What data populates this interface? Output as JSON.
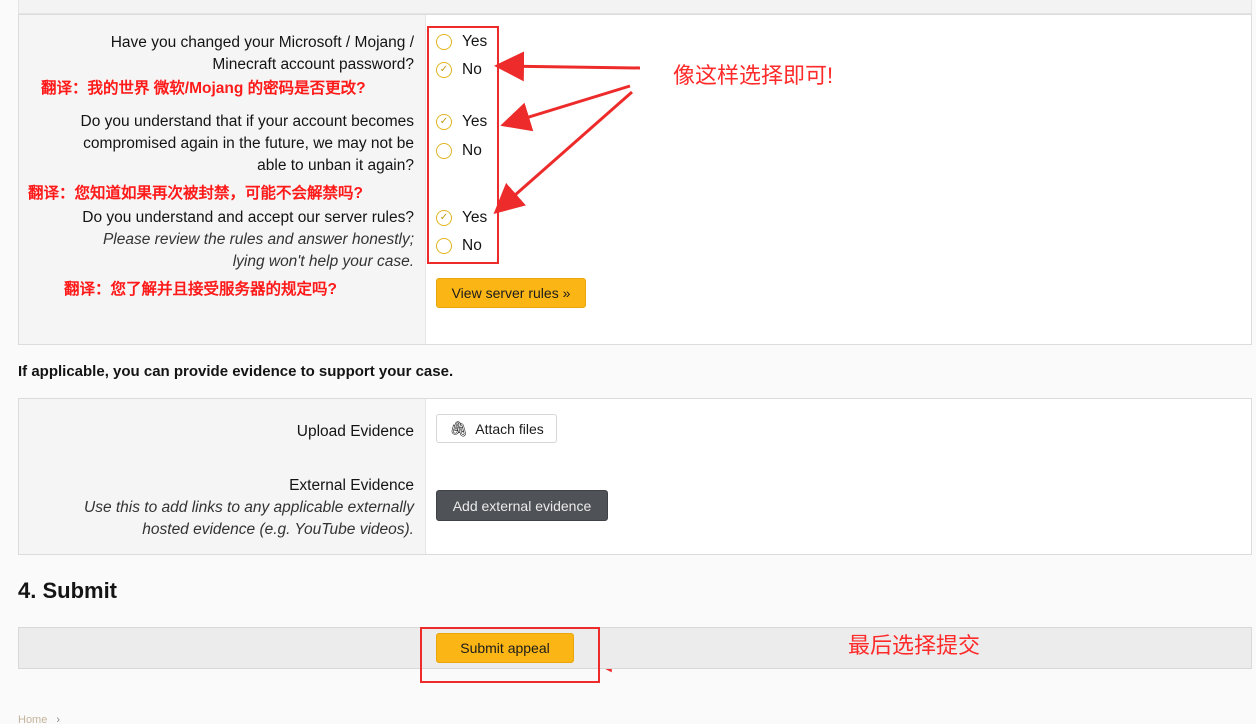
{
  "questions": [
    {
      "label_line1": "Have you changed your Microsoft / Mojang /",
      "label_line2": "Minecraft account password?",
      "yes": "Yes",
      "no": "No",
      "selected": "no"
    },
    {
      "label_line1": "Do you understand that if your account becomes",
      "label_line2": "compromised again in the future, we may not be",
      "label_line3": "able to unban it again?",
      "yes": "Yes",
      "no": "No",
      "selected": "yes"
    },
    {
      "label_line1": "Do you understand and accept our server rules?",
      "hint_line1": "Please review the rules and answer honestly;",
      "hint_line2": "lying won't help your case.",
      "yes": "Yes",
      "no": "No",
      "selected": "yes"
    }
  ],
  "translations": {
    "q1": "翻译：我的世界 微软/Mojang 的密码是否更改?",
    "q2": "翻译：您知道如果再次被封禁，可能不会解禁吗?",
    "q3": "翻译：您了解并且接受服务器的规定吗?"
  },
  "annotations": {
    "choose": "像这样选择即可!",
    "submit": "最后选择提交"
  },
  "buttons": {
    "view_rules": "View server rules »",
    "attach_files": "Attach files",
    "add_external": "Add external evidence",
    "submit_appeal": "Submit appeal"
  },
  "evidence": {
    "intro": "If applicable, you can provide evidence to support your case.",
    "upload_label": "Upload Evidence",
    "external_label": "External Evidence",
    "external_hint_line1": "Use this to add links to any applicable externally",
    "external_hint_line2": "hosted evidence (e.g. YouTube videos)."
  },
  "submit_section": {
    "title": "4. Submit"
  },
  "footer": {
    "breadcrumb": "Home"
  },
  "colors": {
    "accent": "#fbb616",
    "annotation_red": "#ee2b2b",
    "radio_ring": "#e0b422"
  }
}
